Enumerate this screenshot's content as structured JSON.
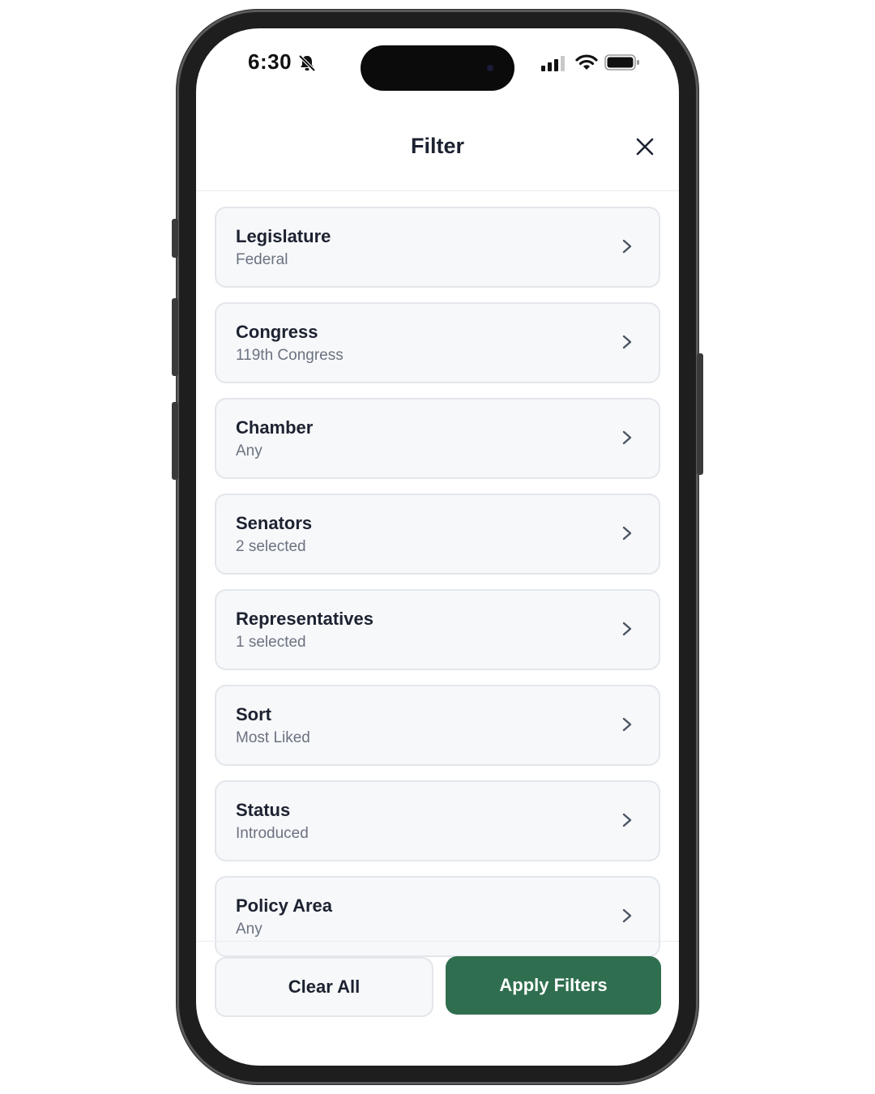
{
  "status_bar": {
    "time": "6:30",
    "icons": [
      "bell-slash-icon",
      "signal-icon",
      "wifi-icon",
      "battery-icon"
    ]
  },
  "header": {
    "title": "Filter",
    "close_icon": "close-icon"
  },
  "filters": [
    {
      "label": "Legislature",
      "value": "Federal"
    },
    {
      "label": "Congress",
      "value": "119th Congress"
    },
    {
      "label": "Chamber",
      "value": "Any"
    },
    {
      "label": "Senators",
      "value": "2 selected"
    },
    {
      "label": "Representatives",
      "value": "1 selected"
    },
    {
      "label": "Sort",
      "value": "Most Liked"
    },
    {
      "label": "Status",
      "value": "Introduced"
    },
    {
      "label": "Policy Area",
      "value": "Any"
    }
  ],
  "footer": {
    "clear_label": "Clear All",
    "apply_label": "Apply Filters"
  },
  "colors": {
    "accent": "#2f6e4e",
    "card_bg": "#f7f8fa",
    "card_border": "#e3e6eb",
    "text_primary": "#1c2230",
    "text_secondary": "#6b7280"
  }
}
